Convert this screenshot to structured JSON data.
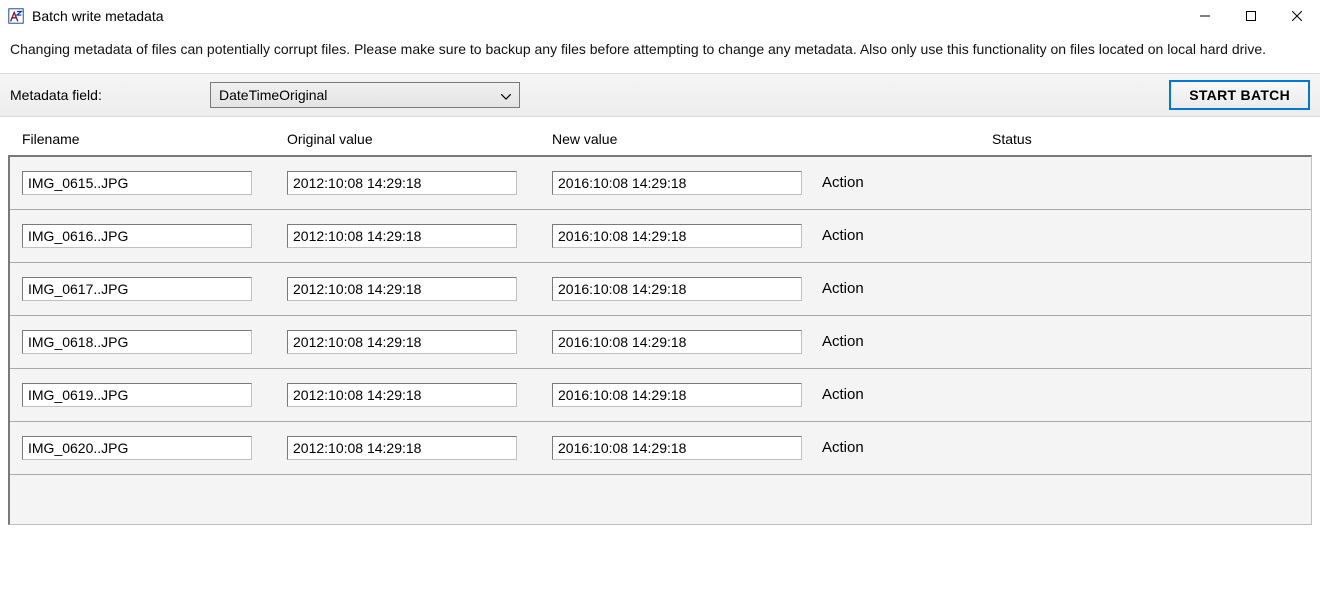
{
  "window": {
    "title": "Batch write metadata"
  },
  "warning_text": "Changing metadata of files can potentially corrupt files. Please make sure to backup any files before attempting to change any metadata. Also only use this functionality on files located on local hard drive.",
  "toolbar": {
    "field_label": "Metadata field:",
    "field_value": "DateTimeOriginal",
    "start_button": "START BATCH"
  },
  "headers": {
    "filename": "Filename",
    "original": "Original value",
    "newval": "New value",
    "status": "Status"
  },
  "rows": [
    {
      "filename": "IMG_0615..JPG",
      "original": "2012:10:08 14:29:18",
      "newval": "2016:10:08 14:29:18",
      "action": "Action",
      "status": ""
    },
    {
      "filename": "IMG_0616..JPG",
      "original": "2012:10:08 14:29:18",
      "newval": "2016:10:08 14:29:18",
      "action": "Action",
      "status": ""
    },
    {
      "filename": "IMG_0617..JPG",
      "original": "2012:10:08 14:29:18",
      "newval": "2016:10:08 14:29:18",
      "action": "Action",
      "status": ""
    },
    {
      "filename": "IMG_0618..JPG",
      "original": "2012:10:08 14:29:18",
      "newval": "2016:10:08 14:29:18",
      "action": "Action",
      "status": ""
    },
    {
      "filename": "IMG_0619..JPG",
      "original": "2012:10:08 14:29:18",
      "newval": "2016:10:08 14:29:18",
      "action": "Action",
      "status": ""
    },
    {
      "filename": "IMG_0620..JPG",
      "original": "2012:10:08 14:29:18",
      "newval": "2016:10:08 14:29:18",
      "action": "Action",
      "status": ""
    }
  ]
}
